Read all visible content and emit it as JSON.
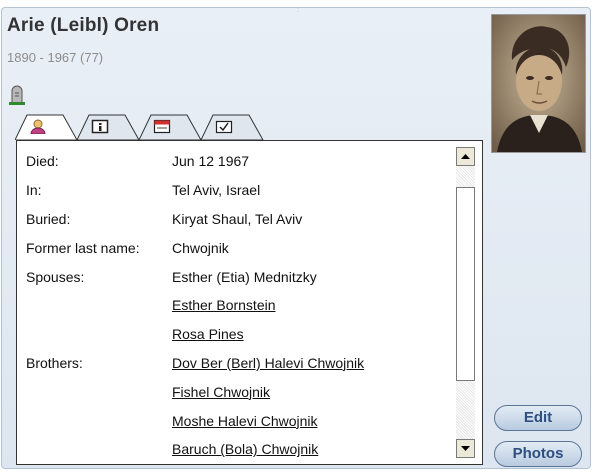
{
  "person": {
    "name": "Arie (Leibl) Oren",
    "dates": "1890 - 1967 (77)"
  },
  "icons": {
    "status": "tombstone-icon",
    "tabs": [
      "person-icon",
      "info-icon",
      "calendar-icon",
      "check-box-icon"
    ],
    "photo": "portrait-photo"
  },
  "details": {
    "rows": [
      {
        "label": "Died:",
        "value": "Jun 12 1967",
        "link": false
      },
      {
        "label": "In:",
        "value": "Tel Aviv, Israel",
        "link": false
      },
      {
        "label": "Buried:",
        "value": "Kiryat Shaul, Tel Aviv",
        "link": false
      },
      {
        "label": "Former last name:",
        "value": "Chwojnik",
        "link": false
      },
      {
        "label": "Spouses:",
        "value": "Esther (Etia) Mednitzky",
        "link": false
      },
      {
        "label": "",
        "value": "Esther Bornstein",
        "link": true
      },
      {
        "label": "",
        "value": "Rosa Pines",
        "link": true
      },
      {
        "label": "Brothers:",
        "value": "Dov Ber (Berl) Halevi Chwojnik",
        "link": true
      },
      {
        "label": "",
        "value": "Fishel Chwojnik",
        "link": true
      },
      {
        "label": "",
        "value": "Moshe Halevi Chwojnik",
        "link": true
      },
      {
        "label": "",
        "value": "Baruch (Bola) Chwojnik",
        "link": true
      }
    ]
  },
  "buttons": {
    "edit": "Edit",
    "photos": "Photos"
  },
  "colors": {
    "panel": "#e3eaf3",
    "button_text": "#2f4f80",
    "tab_active": "#ffffff",
    "tab_inactive": "#dfe6ee"
  }
}
